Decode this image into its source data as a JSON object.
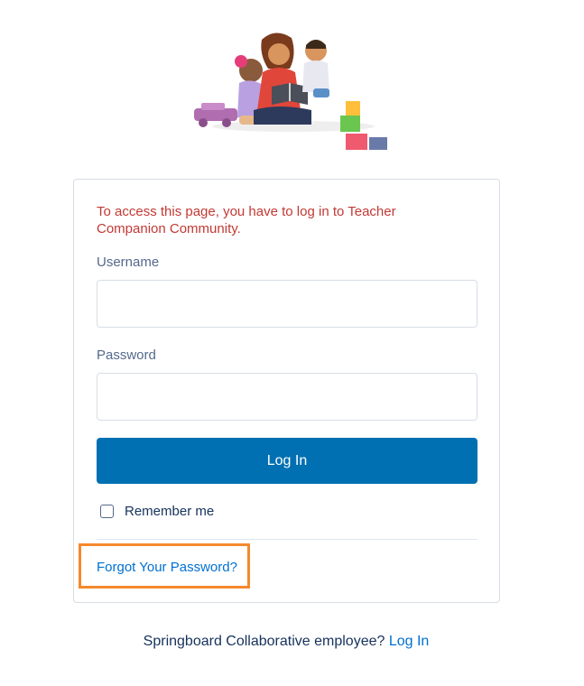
{
  "error_message": "To access this page, you have to log in to Teacher Companion Community.",
  "username": {
    "label": "Username",
    "value": "",
    "placeholder": ""
  },
  "password": {
    "label": "Password",
    "value": "",
    "placeholder": ""
  },
  "login_button": "Log In",
  "remember_me": {
    "label": "Remember me",
    "checked": false
  },
  "forgot_password": "Forgot Your Password?",
  "footer": {
    "prompt": "Springboard Collaborative employee?",
    "link": "Log In"
  },
  "colors": {
    "primary": "#0070b2",
    "link": "#0070d2",
    "error": "#c23934",
    "highlight": "#f5892d"
  },
  "icons": {
    "logo": "family-reading-illustration"
  }
}
